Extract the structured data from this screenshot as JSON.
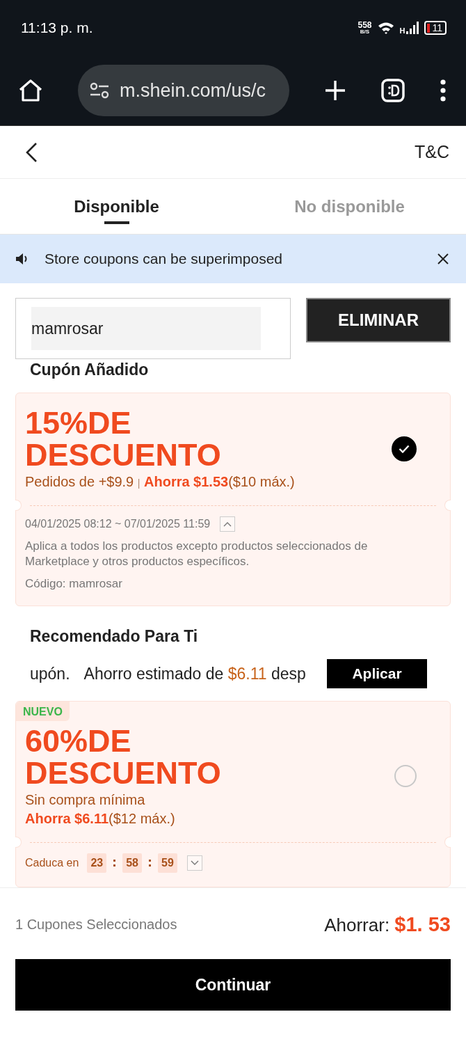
{
  "status_bar": {
    "time": "11:13 p. m.",
    "speed": "558",
    "speed_unit": "B/S",
    "network": "H",
    "battery": "11"
  },
  "browser": {
    "url": "m.shein.com/us/c"
  },
  "header": {
    "link": "T&C"
  },
  "tabs": [
    {
      "label": "Disponible",
      "selected": true
    },
    {
      "label": "No disponible",
      "selected": false
    }
  ],
  "notice": {
    "text": "Store coupons can be superimposed"
  },
  "code_field": {
    "value": "mamrosar"
  },
  "remove_button": "ELIMINAR",
  "added_title": "Cupón Añadido",
  "added_coupons": [
    {
      "kind": "detailed",
      "title": "15%DE DESCUENTO",
      "condition": "Pedidos de +$9.9",
      "separator": "|",
      "saving": "Ahorra $1.53",
      "cap": "($10 máx.)",
      "selected": true,
      "period": "04/01/2025 08:12 ~ 07/01/2025 11:59",
      "expanded": true,
      "description": "Aplica a todos los productos excepto productos seleccionados de Marketplace y otros productos específicos.",
      "code": "Código: mamrosar"
    }
  ],
  "recommended_title": "Recomendado Para Ti",
  "ticker": {
    "lead": "upón.",
    "text": "Ahorro estimado de ",
    "amount": "$6.11",
    "tail": " desp"
  },
  "apply_button": "Aplicar",
  "recommended_coupons": [
    {
      "kind": "timed",
      "badge": "NUEVO",
      "title": "60%DE DESCUENTO",
      "condition": "Sin compra mínima",
      "saving": "Ahorra $6.11",
      "cap": "($12 máx.)",
      "selected": false,
      "expires_label": "Caduca en",
      "countdown": [
        "23",
        "58",
        "59"
      ],
      "expanded": false
    }
  ],
  "footer": {
    "selected_count": "1 Cupones Seleccionados",
    "saving_label": "Ahorrar:",
    "saving_amount": "$1. 53",
    "continue_button": "Continuar"
  }
}
